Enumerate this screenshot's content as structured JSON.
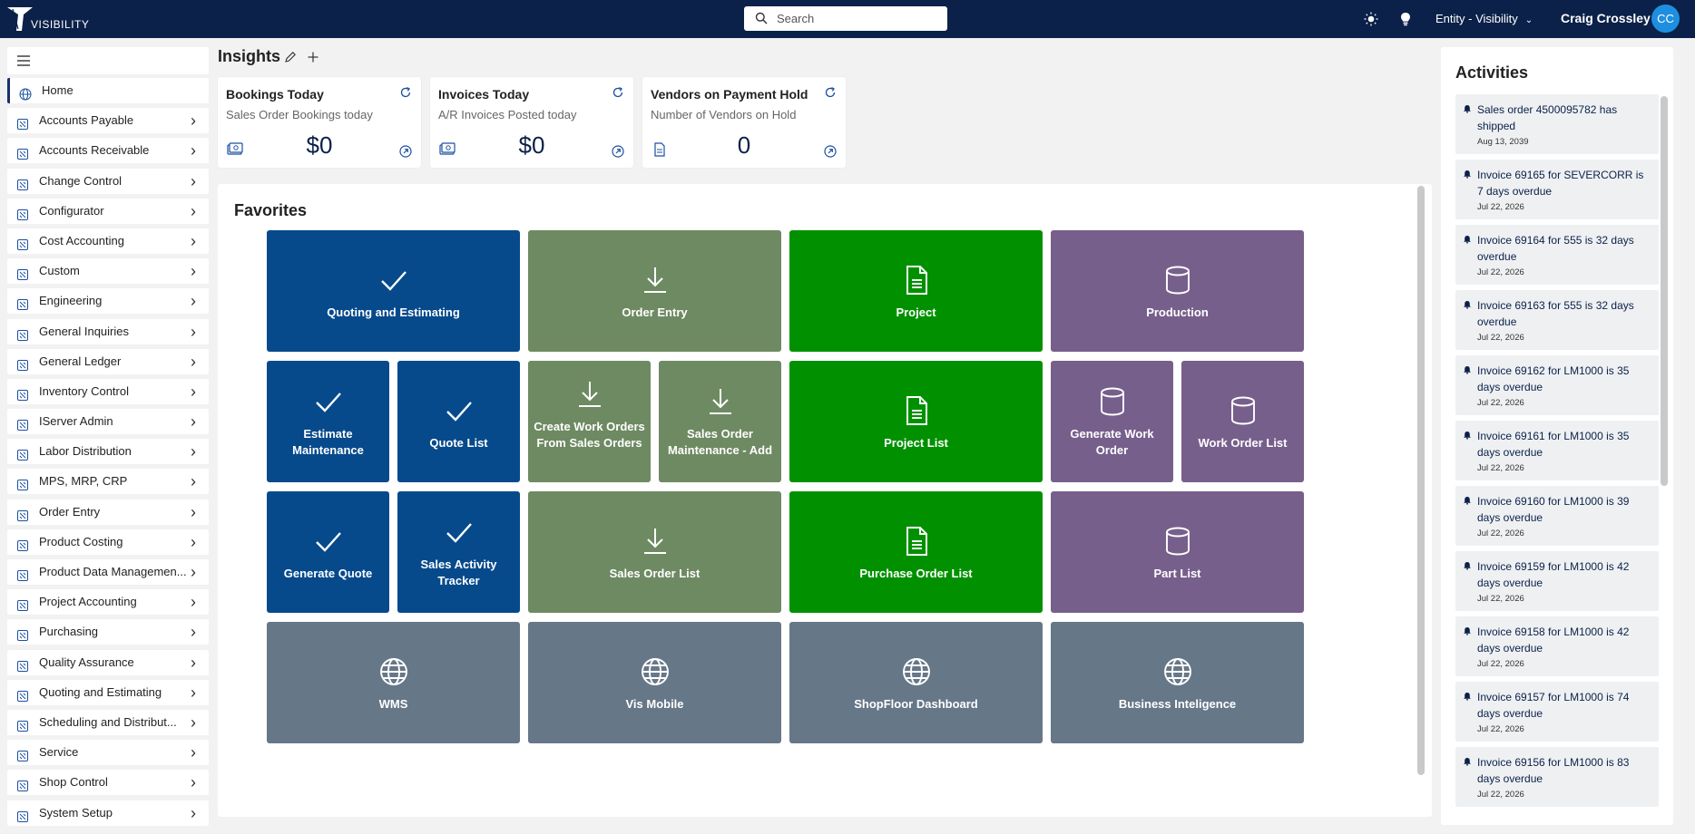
{
  "header": {
    "logo_text": "VISIBILITY",
    "search_placeholder": "Search",
    "entity_label": "Entity - Visibility",
    "user_name": "Craig Crossley",
    "user_initials": "CC"
  },
  "sidebar": {
    "items": [
      {
        "label": "Home",
        "icon": "globe-icon"
      },
      {
        "label": "Accounts Payable",
        "icon": "module-icon"
      },
      {
        "label": "Accounts Receivable",
        "icon": "module-icon"
      },
      {
        "label": "Change Control",
        "icon": "module-icon"
      },
      {
        "label": "Configurator",
        "icon": "module-icon"
      },
      {
        "label": "Cost Accounting",
        "icon": "module-icon"
      },
      {
        "label": "Custom",
        "icon": "module-icon"
      },
      {
        "label": "Engineering",
        "icon": "module-icon"
      },
      {
        "label": "General Inquiries",
        "icon": "module-icon"
      },
      {
        "label": "General Ledger",
        "icon": "module-icon"
      },
      {
        "label": "Inventory Control",
        "icon": "module-icon"
      },
      {
        "label": "IServer Admin",
        "icon": "module-icon"
      },
      {
        "label": "Labor Distribution",
        "icon": "module-icon"
      },
      {
        "label": "MPS, MRP, CRP",
        "icon": "module-icon"
      },
      {
        "label": "Order Entry",
        "icon": "module-icon"
      },
      {
        "label": "Product Costing",
        "icon": "module-icon"
      },
      {
        "label": "Product Data Managemen...",
        "icon": "module-icon"
      },
      {
        "label": "Project Accounting",
        "icon": "module-icon"
      },
      {
        "label": "Purchasing",
        "icon": "module-icon"
      },
      {
        "label": "Quality Assurance",
        "icon": "module-icon"
      },
      {
        "label": "Quoting and Estimating",
        "icon": "module-icon"
      },
      {
        "label": "Scheduling and Distribut...",
        "icon": "module-icon"
      },
      {
        "label": "Service",
        "icon": "module-icon"
      },
      {
        "label": "Shop Control",
        "icon": "module-icon"
      },
      {
        "label": "System Setup",
        "icon": "module-icon"
      }
    ]
  },
  "insights": {
    "title": "Insights",
    "cards": [
      {
        "title": "Bookings Today",
        "subtitle": "Sales Order Bookings today",
        "value": "$0",
        "icon": "money-icon"
      },
      {
        "title": "Invoices Today",
        "subtitle": "A/R Invoices Posted today",
        "value": "$0",
        "icon": "money-icon"
      },
      {
        "title": "Vendors on Payment Hold",
        "subtitle": "Number of Vendors on Hold",
        "value": "0",
        "icon": "document-icon"
      }
    ]
  },
  "favorites": {
    "title": "Favorites",
    "tiles": [
      {
        "label": "Quoting and Estimating",
        "icon": "check-icon",
        "color": "#064a8c"
      },
      {
        "label": "Order Entry",
        "icon": "download-icon",
        "color": "#6e8a62"
      },
      {
        "label": "Project",
        "icon": "document-icon",
        "color": "#019100"
      },
      {
        "label": "Production",
        "icon": "database-icon",
        "color": "#775f8c"
      },
      {
        "label": "Estimate Maintenance",
        "icon": "check-icon",
        "color": "#064a8c"
      },
      {
        "label": "Quote List",
        "icon": "check-icon",
        "color": "#064a8c"
      },
      {
        "label": "Create Work Orders From Sales Orders",
        "icon": "download-icon",
        "color": "#6e8a62"
      },
      {
        "label": "Sales Order Maintenance - Add",
        "icon": "download-icon",
        "color": "#6e8a62"
      },
      {
        "label": "Project List",
        "icon": "document-icon",
        "color": "#019100"
      },
      {
        "label": "Generate Work Order",
        "icon": "database-icon",
        "color": "#775f8c"
      },
      {
        "label": "Work Order List",
        "icon": "database-icon",
        "color": "#775f8c"
      },
      {
        "label": "Generate Quote",
        "icon": "check-icon",
        "color": "#064a8c"
      },
      {
        "label": "Sales Activity Tracker",
        "icon": "check-icon",
        "color": "#064a8c"
      },
      {
        "label": "Sales Order List",
        "icon": "download-icon",
        "color": "#6e8a62"
      },
      {
        "label": "Purchase Order List",
        "icon": "document-icon",
        "color": "#019100"
      },
      {
        "label": "Part List",
        "icon": "database-icon",
        "color": "#775f8c"
      },
      {
        "label": "WMS",
        "icon": "globe-icon",
        "color": "#667788"
      },
      {
        "label": "Vis Mobile",
        "icon": "globe-icon",
        "color": "#667788"
      },
      {
        "label": "ShopFloor Dashboard",
        "icon": "globe-icon",
        "color": "#667788"
      },
      {
        "label": "Business Inteligence",
        "icon": "globe-icon",
        "color": "#667788"
      }
    ]
  },
  "activities": {
    "title": "Activities",
    "items": [
      {
        "text": "Sales order 4500095782 has shipped",
        "date": "Aug 13, 2039"
      },
      {
        "text": "Invoice 69165 for SEVERCORR is 7 days overdue",
        "date": "Jul 22, 2026"
      },
      {
        "text": "Invoice 69164 for 555 is 32 days overdue",
        "date": "Jul 22, 2026"
      },
      {
        "text": "Invoice 69163 for 555 is 32 days overdue",
        "date": "Jul 22, 2026"
      },
      {
        "text": "Invoice 69162 for LM1000 is 35 days overdue",
        "date": "Jul 22, 2026"
      },
      {
        "text": "Invoice 69161 for LM1000 is 35 days overdue",
        "date": "Jul 22, 2026"
      },
      {
        "text": "Invoice 69160 for LM1000 is 39 days overdue",
        "date": "Jul 22, 2026"
      },
      {
        "text": "Invoice 69159 for LM1000 is 42 days overdue",
        "date": "Jul 22, 2026"
      },
      {
        "text": "Invoice 69158 for LM1000 is 42 days overdue",
        "date": "Jul 22, 2026"
      },
      {
        "text": "Invoice 69157 for LM1000 is 74 days overdue",
        "date": "Jul 22, 2026"
      },
      {
        "text": "Invoice 69156 for LM1000 is 83 days overdue",
        "date": "Jul 22, 2026"
      }
    ]
  }
}
